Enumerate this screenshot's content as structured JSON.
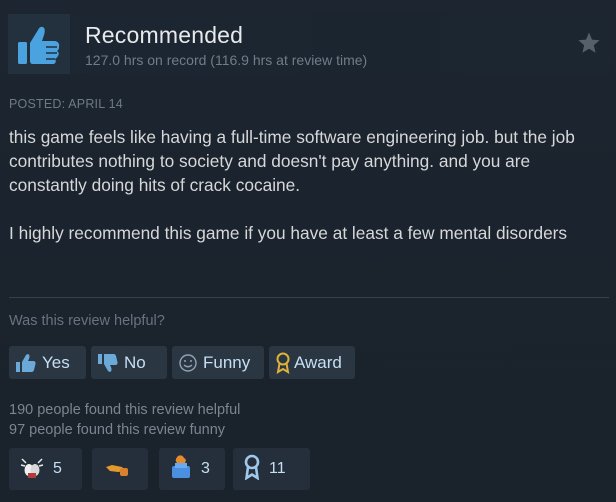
{
  "review": {
    "title": "Recommended",
    "hours": "127.0 hrs on record (116.9 hrs at review time)",
    "posted": "POSTED: APRIL 14",
    "paragraphs": [
      "this game feels like having a full-time software engineering job. but the job contributes nothing to society and doesn't pay anything. and you are constantly doing hits of crack cocaine.",
      "I highly recommend this game if you have at least a few mental disorders"
    ]
  },
  "helpful": {
    "question": "Was this review helpful?",
    "buttons": {
      "yes": "Yes",
      "no": "No",
      "funny": "Funny",
      "award": "Award"
    }
  },
  "counts": {
    "helpful": "190 people found this review helpful",
    "funny": "97 people found this review funny"
  },
  "awards": [
    {
      "icon": "clapping-award-icon",
      "count": "5"
    },
    {
      "icon": "hot-take-award-icon",
      "count": ""
    },
    {
      "icon": "mind-blown-award-icon",
      "count": "3"
    },
    {
      "icon": "ribbon-award-icon",
      "count": "11"
    }
  ],
  "colors": {
    "background": "#1a222c",
    "button_bg": "#2b3643",
    "button_text": "#c6dff2",
    "thumb": "#4aa3df",
    "award_gold": "#e0b23a"
  }
}
